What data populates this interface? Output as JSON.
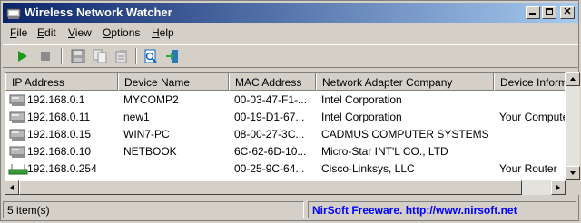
{
  "window": {
    "title": "Wireless Network Watcher"
  },
  "menu": [
    {
      "label": "File",
      "underline": "F",
      "rest": "ile"
    },
    {
      "label": "Edit",
      "underline": "E",
      "rest": "dit"
    },
    {
      "label": "View",
      "underline": "V",
      "rest": "iew"
    },
    {
      "label": "Options",
      "underline": "O",
      "rest": "ptions"
    },
    {
      "label": "Help",
      "underline": "H",
      "rest": "elp"
    }
  ],
  "toolbar": {
    "icons": [
      "play-icon",
      "stop-icon",
      "save-icon",
      "copy-icon",
      "properties-icon",
      "html-report-icon",
      "exit-icon"
    ]
  },
  "columns": [
    "IP Address",
    "Device Name",
    "MAC Address",
    "Network Adapter Company",
    "Device Informati"
  ],
  "rows": [
    {
      "ip": "192.168.0.1",
      "name": "MYCOMP2",
      "mac": "00-03-47-F1-...",
      "company": "Intel Corporation",
      "info": "",
      "icon": "computer-icon"
    },
    {
      "ip": "192.168.0.11",
      "name": "new1",
      "mac": "00-19-D1-67...",
      "company": "Intel Corporation",
      "info": "Your Computer",
      "icon": "computer-icon"
    },
    {
      "ip": "192.168.0.15",
      "name": "WIN7-PC",
      "mac": "08-00-27-3C...",
      "company": "CADMUS COMPUTER SYSTEMS",
      "info": "",
      "icon": "computer-icon"
    },
    {
      "ip": "192.168.0.10",
      "name": "NETBOOK",
      "mac": "6C-62-6D-10...",
      "company": "Micro-Star INT'L CO., LTD",
      "info": "",
      "icon": "computer-icon"
    },
    {
      "ip": "192.168.0.254",
      "name": "",
      "mac": "00-25-9C-64...",
      "company": "Cisco-Linksys, LLC",
      "info": "Your Router",
      "icon": "router-icon"
    }
  ],
  "status": {
    "count": "5 item(s)",
    "credit": "NirSoft Freeware.  http://www.nirsoft.net"
  }
}
